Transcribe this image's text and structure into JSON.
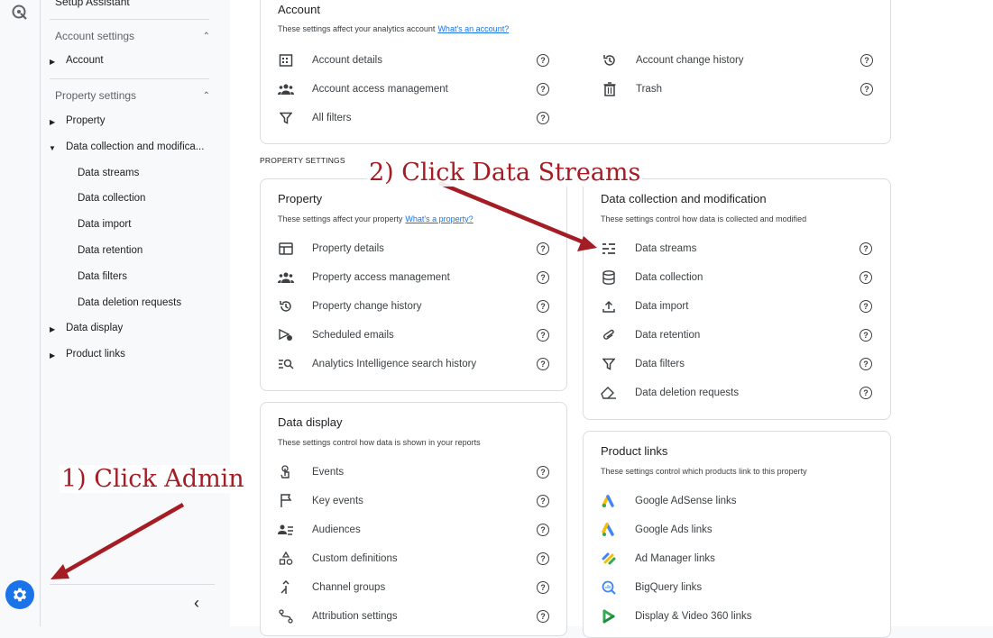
{
  "sidebar": {
    "setup_assistant": "Setup Assistant",
    "account_settings": "Account settings",
    "account_items": [
      {
        "label": "Account"
      }
    ],
    "property_settings": "Property settings",
    "property_items": [
      {
        "label": "Property"
      },
      {
        "label": "Data collection and modifica..."
      },
      {
        "label": "Data streams"
      },
      {
        "label": "Data collection"
      },
      {
        "label": "Data import"
      },
      {
        "label": "Data retention"
      },
      {
        "label": "Data filters"
      },
      {
        "label": "Data deletion requests"
      },
      {
        "label": "Data display"
      },
      {
        "label": "Product links"
      }
    ]
  },
  "account_card": {
    "title": "Account",
    "desc": "These settings affect your analytics account",
    "link": "What's an account?",
    "left": [
      {
        "label": "Account details",
        "icon": "building-icon"
      },
      {
        "label": "Account access management",
        "icon": "people-icon"
      },
      {
        "label": "All filters",
        "icon": "filter-icon"
      }
    ],
    "right": [
      {
        "label": "Account change history",
        "icon": "history-icon"
      },
      {
        "label": "Trash",
        "icon": "trash-icon"
      }
    ]
  },
  "property_settings_header": "PROPERTY SETTINGS",
  "property_card": {
    "title": "Property",
    "desc": "These settings affect your property",
    "link": "What's a property?",
    "items": [
      {
        "label": "Property details"
      },
      {
        "label": "Property access management"
      },
      {
        "label": "Property change history"
      },
      {
        "label": "Scheduled emails"
      },
      {
        "label": "Analytics Intelligence search history"
      }
    ]
  },
  "data_collection_card": {
    "title": "Data collection and modification",
    "desc": "These settings control how data is collected and modified",
    "items": [
      {
        "label": "Data streams"
      },
      {
        "label": "Data collection"
      },
      {
        "label": "Data import"
      },
      {
        "label": "Data retention"
      },
      {
        "label": "Data filters"
      },
      {
        "label": "Data deletion requests"
      }
    ]
  },
  "data_display_card": {
    "title": "Data display",
    "desc": "These settings control how data is shown in your reports",
    "items": [
      {
        "label": "Events"
      },
      {
        "label": "Key events"
      },
      {
        "label": "Audiences"
      },
      {
        "label": "Custom definitions"
      },
      {
        "label": "Channel groups"
      },
      {
        "label": "Attribution settings"
      }
    ]
  },
  "product_links_card": {
    "title": "Product links",
    "desc": "These settings control which products link to this property",
    "items": [
      {
        "label": "Google AdSense links"
      },
      {
        "label": "Google Ads links"
      },
      {
        "label": "Ad Manager links"
      },
      {
        "label": "BigQuery links"
      },
      {
        "label": "Display & Video 360 links"
      }
    ]
  },
  "help_glyph": "?",
  "annotations": {
    "step1": "1) Click Admin",
    "step2": "2) Click Data Streams",
    "color": "#a51d24"
  },
  "colors": {
    "accent": "#1a73e8",
    "border": "#dadce0"
  }
}
